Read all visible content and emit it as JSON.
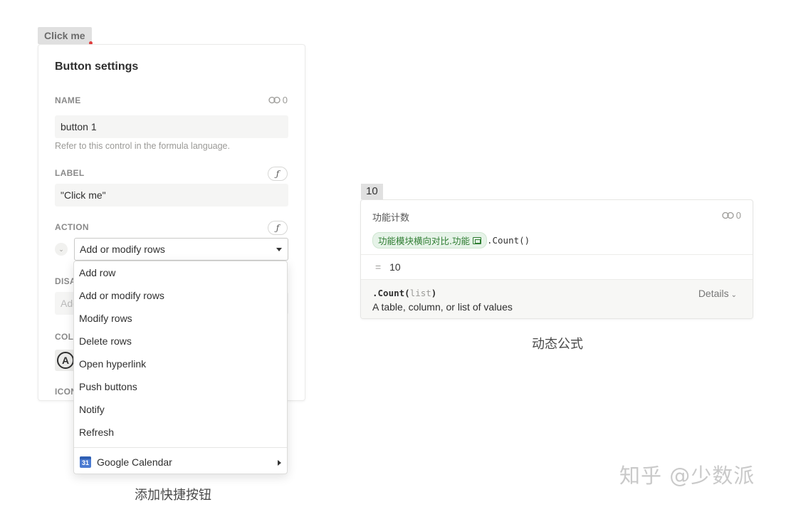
{
  "left_panel": {
    "chip_label": "Click me",
    "title": "Button settings",
    "name_section": {
      "label": "NAME",
      "link_count": "0",
      "value": "button 1",
      "helper": "Refer to this control in the formula language."
    },
    "label_section": {
      "label": "LABEL",
      "formula_icon": "ƒ",
      "value": "\"Click me\""
    },
    "action_section": {
      "label": "ACTION",
      "formula_icon": "ƒ",
      "selected": "Add or modify rows"
    },
    "disabled_section": {
      "label": "DISA",
      "placeholder": "Add"
    },
    "color_section": {
      "label": "COLO",
      "swatch_glyph": "A"
    },
    "icon_section": {
      "label": "ICON"
    },
    "dropdown": {
      "items": [
        "Add row",
        "Add or modify rows",
        "Modify rows",
        "Delete rows",
        "Open hyperlink",
        "Push buttons",
        "Notify",
        "Refresh"
      ],
      "integration": {
        "label": "Google Calendar",
        "icon_text": "31"
      }
    },
    "caption": "添加快捷按钮"
  },
  "right_panel": {
    "value_chip": "10",
    "formula_name": "功能计数",
    "link_count": "0",
    "reference": "功能模块横向对比.功能",
    "method": ".Count()",
    "result_eq": "=",
    "result_value": "10",
    "doc_signature_name": ".Count(",
    "doc_signature_param": "list",
    "doc_signature_close": ")",
    "doc_description": "A table, column, or list of values",
    "details_label": "Details",
    "caption": "动态公式"
  },
  "watermark": "知乎 @少数派",
  "colors": {
    "reference_green": "#2f7d32",
    "reference_bg": "#e6f3e8",
    "alert_dot": "#e03e3e",
    "calendar_blue": "#4a7ad1"
  },
  "icons": {
    "link": "link-icon",
    "formula": "formula-icon",
    "caret": "caret-down-icon",
    "submenu": "caret-right-icon",
    "calendar": "google-calendar-icon",
    "table_ref": "table-icon"
  }
}
